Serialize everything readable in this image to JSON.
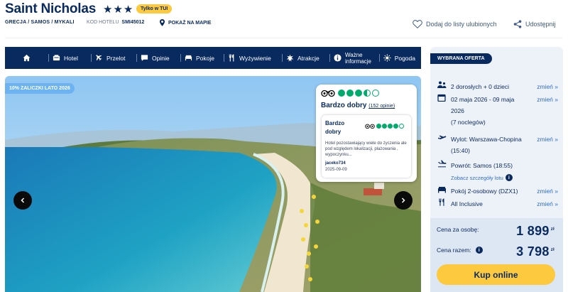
{
  "hotel": {
    "name": "Saint Nicholas",
    "stars": "★★★",
    "exclusive_badge": "Tylko w TUI",
    "breadcrumb": "GRECJA / SAMOS / MYKALI",
    "code_label": "KOD HOTELU",
    "code_value": "SMI45012",
    "map_link": "POKAŻ NA MAPIE",
    "favorites_link": "Dodaj do listy ulubionych",
    "share_link": "Udostępnij"
  },
  "nav": {
    "items": [
      {
        "label": "",
        "icon": "home-icon"
      },
      {
        "label": "Hotel",
        "icon": "hotel-icon"
      },
      {
        "label": "Przelot",
        "icon": "plane-icon"
      },
      {
        "label": "Opinie",
        "icon": "speech-bubble-icon"
      },
      {
        "label": "Pokoje",
        "icon": "bed-icon"
      },
      {
        "label": "Wyżywienie",
        "icon": "cutlery-icon"
      },
      {
        "label": "Atrakcje",
        "icon": "attractions-icon"
      },
      {
        "label": "Ważne informacje",
        "icon": "info-icon"
      },
      {
        "label": "Pogoda",
        "icon": "sun-icon"
      }
    ],
    "info_line1": "Ważne",
    "info_line2": "informacje"
  },
  "gallery": {
    "badge": "10% ZALICZKI LATO 2026",
    "prev_icon": "chevron-left-icon",
    "next_icon": "chevron-right-icon"
  },
  "tripadvisor": {
    "rating_dots": 3.5,
    "label": "Bardzo dobry",
    "count": "(152 opinie)",
    "review": {
      "title": "Bardzo dobry",
      "rating_dots": 4,
      "text": "Hotel pozostawiający wiele do życzenia ale pod względem lokalizacji, plażowania , wypoczynku...",
      "author": "jaceko734",
      "date": "2025-09-09"
    }
  },
  "offer": {
    "badge": "WYBRANA OFERTA",
    "change_label": "zmień »",
    "guests": "2 dorosłych + 0 dzieci",
    "dates_line1": "02 maja 2026 - 09 maja",
    "dates_line2": "2026",
    "nights": "(7 noclegów)",
    "departure_line1": "Wylot: Warszawa-Chopina",
    "departure_line2": "(15:40)",
    "return": "Powrót: Samos (18:55)",
    "flight_details": "Zobacz szczegóły lotu",
    "room": "Pokój 2-osobowy (DZX1)",
    "board": "All Inclusive",
    "price_per_person_label": "Cena za osobę:",
    "price_per_person": "1 899",
    "price_total_label": "Cena razem:",
    "price_total": "3 798",
    "currency": "zł",
    "buy_button": "Kup online"
  },
  "colors": {
    "navy": "#092a5e",
    "yellow": "#fcc93f",
    "link_blue": "#2f6fce",
    "tripadvisor_green": "#00aa6c"
  }
}
